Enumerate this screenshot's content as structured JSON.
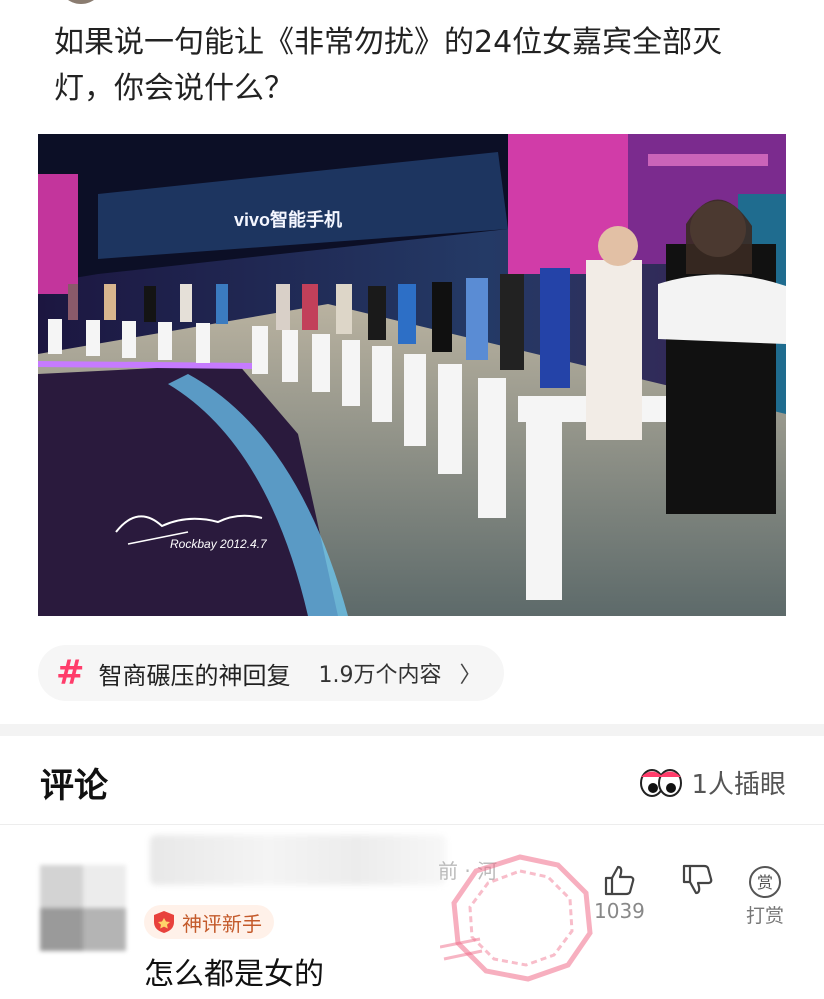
{
  "question": {
    "title": "如果说一句能让《非常勿扰》的24位女嘉宾全部灭灯，你会说什么？"
  },
  "image": {
    "screen_text": "vivo智能手机",
    "signature": "Rockbay 2012.4.7"
  },
  "topic": {
    "icon": "hash-icon",
    "name": "智商碾压的神回复",
    "count": "1.9万个内容",
    "chevron": "〉"
  },
  "comments": {
    "title": "评论",
    "eyes_icon": "eyes-icon",
    "watch_label": "1人插眼"
  },
  "comment": {
    "meta": "前 · 河",
    "badge": "神评新手",
    "text": "怎么都是女的",
    "like_count": "1039",
    "reward_label": "打赏",
    "reward_glyph": "赏"
  },
  "colors": {
    "accent": "#ff3d6b",
    "badge_bg": "#fff1e9",
    "badge_text": "#c45a2b",
    "stamp": "#f06d8a"
  }
}
